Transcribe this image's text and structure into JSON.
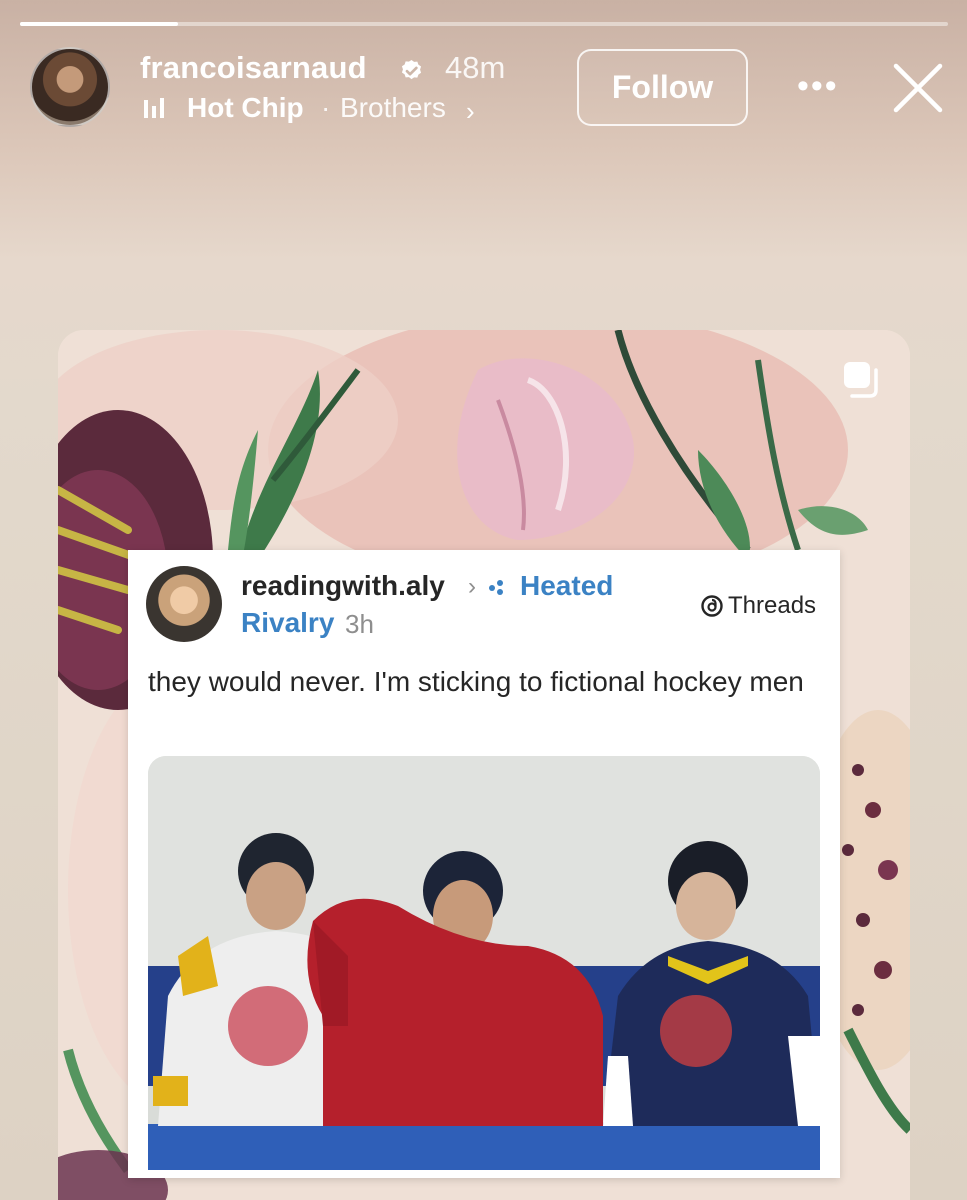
{
  "story": {
    "progress": 0.17
  },
  "header": {
    "username": "francoisarnaud",
    "verified_icon": "verified-badge-icon",
    "time": "48m",
    "music": {
      "icon": "music-bars-icon",
      "artist": "Hot Chip",
      "separator": "·",
      "song": "Brothers",
      "chevron": "›"
    },
    "follow_label": "Follow",
    "more_icon": "more-horizontal-icon",
    "more_label": "•••",
    "close_icon": "close-icon"
  },
  "card": {
    "multi_icon": "multiple-media-icon"
  },
  "post": {
    "username": "readingwith.aly",
    "chevron": "›",
    "community_line1": "Heated",
    "community_line2": "Rivalry",
    "time": "3h",
    "platform": "Threads",
    "text": "they would never. I'm sticking to fictional hockey men"
  },
  "colors": {
    "accent_link": "#3b82c4",
    "text_primary": "#262626",
    "text_secondary": "#8e8e8e"
  }
}
